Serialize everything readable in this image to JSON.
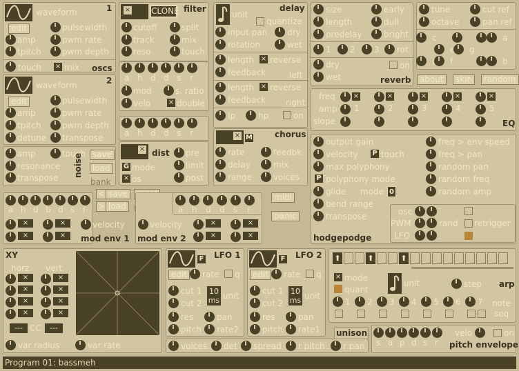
{
  "osc1": {
    "num": "1",
    "waveform": "waveform",
    "edit": "edit",
    "pulsewidth": "pulsewidth",
    "amp": "amp",
    "pwm_rate": "pwm rate",
    "tpitch": "tpitch",
    "pwm_depth": "pwm depth",
    "touch": "touch",
    "mix": "mix",
    "oscs": "oscs"
  },
  "osc2": {
    "num": "2",
    "waveform": "waveform",
    "edit": "edit",
    "pulsewidth": "pulsewidth",
    "amp": "amp",
    "pwm_rate": "pwm rate",
    "tpitch": "tpitch",
    "pwm_depth": "pwm depth",
    "detune": "detune",
    "transpose": "transpose"
  },
  "noise": {
    "amp": "amp",
    "touch": "touch",
    "resonance": "resonance",
    "transpose": "transpose",
    "label": "noise",
    "save": "save",
    "load": "load",
    "bank": "bank"
  },
  "filter": {
    "title": "filter",
    "clone": "CLONE",
    "cutoff": "cutoff",
    "split": "split",
    "track": "track",
    "mix": "mix",
    "reso": "reso",
    "touch": "touch",
    "adsr": [
      "a",
      "h",
      "d",
      "d",
      "s",
      "r"
    ],
    "mod": "mod",
    "s_ratio": "s. ratio",
    "velo": "velo",
    "double": "double"
  },
  "dist": {
    "adsr": [
      "a",
      "h",
      "d",
      "d",
      "s",
      "r"
    ],
    "title": "dist",
    "pre": "pre",
    "mode": "mode",
    "limit": "limit",
    "os": "os",
    "post": "post",
    "g": "G"
  },
  "delay": {
    "title": "delay",
    "unit": "unit",
    "quantize": "quantize",
    "input_pan": "input pan",
    "dry": "dry",
    "rotation": "rotation",
    "wet": "wet",
    "length": "length",
    "reverse": "reverse",
    "feedback": "feedback",
    "left": "left",
    "right": "right",
    "lp": "lp",
    "hp": "hp",
    "on": "on"
  },
  "chorus": {
    "title": "chorus",
    "m": "M",
    "rate": "rate",
    "feedbk": "feedbk",
    "delay": "delay",
    "mix": "mix",
    "range": "range",
    "voices": "voices"
  },
  "reverb": {
    "size": "size",
    "early": "early",
    "length": "length",
    "dull": "dull",
    "predelay": "predelay",
    "bright": "bright",
    "n1": "1",
    "n2": "2",
    "n3": "3",
    "rot": "rot",
    "dry": "dry",
    "on": "on",
    "wet": "wet",
    "title": "reverb"
  },
  "tune": {
    "tune": "tune",
    "cut_ref": "cut ref",
    "octave": "octave",
    "pan_ref": "pan ref",
    "notes": [
      "c",
      "e",
      "g",
      "d",
      "f",
      "a",
      "b"
    ],
    "about": "about",
    "skin": "skin",
    "random": "random"
  },
  "eq": {
    "freq": "freq",
    "amp": "amp",
    "slope": "slope",
    "bands": [
      "1",
      "2",
      "3",
      "4",
      "5"
    ],
    "title": "EQ"
  },
  "hodge": {
    "output_gain": "output gain",
    "freq_env_speed": "freq > env speed",
    "velocity": "velocity",
    "p": "P",
    "touch": "touch",
    "freq_pan": "freq > pan",
    "max_poly": "max polyphony",
    "random_pan": "random pan",
    "poly_mode": "polyphony mode",
    "random_freq": "random freq",
    "glide": "glide",
    "mode": "mode",
    "mode_val": "0",
    "random_amp": "random amp",
    "bend_range": "bend range",
    "osc": "osc",
    "pwm": "PWM",
    "rand": "rand",
    "retrigger": "retrigger",
    "lfo": "LFO",
    "transpose": "transpose",
    "title": "hodgepodge"
  },
  "modenv1": {
    "adsr": [
      "a",
      "h",
      "d",
      "b",
      "d",
      "s",
      "r"
    ],
    "velocity": "velocity",
    "title": "mod env 1"
  },
  "modenv2": {
    "adsr": [
      "a",
      "h",
      "d",
      "d",
      "s",
      "r"
    ],
    "velocity": "velocity",
    "title": "mod env 2",
    "save": "save",
    "reset": "reset",
    "load": "load",
    "patch": "patch",
    "midi": "midi",
    "panic": "panic"
  },
  "xy": {
    "title": "XY",
    "horz": "horz",
    "vert": "vert",
    "cc": "CC",
    "cc1": "---",
    "cc2": "---",
    "var_radius": "var radius",
    "var_rate": "var rate"
  },
  "lfo1": {
    "title": "LFO 1",
    "f": "F",
    "edit": "edit",
    "rate": "rate",
    "q": "q",
    "cut1": "cut 1",
    "cut2": "cut 2",
    "ms": "10 ms",
    "unit": "unit",
    "res": "res",
    "pan": "pan",
    "pitch": "pitch",
    "rate2": "rate2"
  },
  "lfo2": {
    "title": "LFO 2",
    "f": "F",
    "edit": "edit",
    "rate": "rate",
    "q": "q",
    "cut1": "cut 1",
    "cut2": "cut 2",
    "ms": "10 ms",
    "unit": "unit",
    "res": "res",
    "pan": "pan",
    "pitch": "pitch",
    "rate1": "rate1"
  },
  "arp": {
    "mode": "mode",
    "quant": "quant",
    "unit": "unit",
    "step": "step",
    "title": "arp",
    "steps": [
      "1",
      "2",
      "3",
      "4",
      "5",
      "6",
      "7"
    ],
    "note": "note",
    "seq": "seq"
  },
  "unison": {
    "title": "unison",
    "voices": "voices",
    "det": "det",
    "spread": "spread",
    "r_pitch": "r pitch",
    "r_pan": "r pan"
  },
  "pitchenv": {
    "adsr": [
      "s",
      "a",
      "p",
      "d",
      "s",
      "r"
    ],
    "velo": "velo",
    "on": "on",
    "title": "pitch envelope"
  },
  "status": {
    "program": "Program 01: bassmeh"
  },
  "colors": {
    "background": "#c5b894",
    "panel": "#d2c5a2",
    "dark": "#4a4226",
    "label": "#f1e5c4",
    "title": "#3b3420"
  }
}
